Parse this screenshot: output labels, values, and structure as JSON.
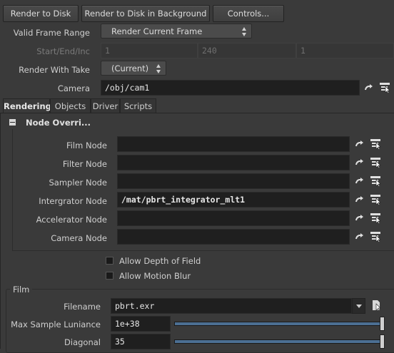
{
  "toolbar": {
    "render_to_disk": "Render to Disk",
    "render_bg": "Render to Disk in Background",
    "controls": "Controls..."
  },
  "params": {
    "valid_frame_range_label": "Valid Frame Range",
    "valid_frame_range_value": "Render Current Frame",
    "start_end_inc_label": "Start/End/Inc",
    "start": "1",
    "end": "240",
    "inc": "1",
    "render_with_take_label": "Render With Take",
    "render_with_take_value": "(Current)",
    "camera_label": "Camera",
    "camera_value": "/obj/cam1"
  },
  "tabs": [
    "Rendering",
    "Objects",
    "Driver",
    "Scripts"
  ],
  "node_overrides": {
    "title": "Node Overri...",
    "rows": [
      {
        "label": "Film Node",
        "value": ""
      },
      {
        "label": "Filter Node",
        "value": ""
      },
      {
        "label": "Sampler Node",
        "value": ""
      },
      {
        "label": "Intergrator Node",
        "value": "/mat/pbrt_integrator_mlt1"
      },
      {
        "label": "Accelerator Node",
        "value": ""
      },
      {
        "label": "Camera Node",
        "value": ""
      }
    ]
  },
  "toggles": {
    "allow_dof": "Allow Depth of Field",
    "allow_motion_blur": "Allow Motion Blur"
  },
  "film": {
    "title": "Film",
    "filename_label": "Filename",
    "filename_value": "pbrt.exr",
    "max_sample_label": "Max Sample Luniance",
    "max_sample_value": "1e+38",
    "max_sample_fraction": 1.0,
    "diagonal_label": "Diagonal",
    "diagonal_value": "35",
    "diagonal_fraction": 1.0
  }
}
